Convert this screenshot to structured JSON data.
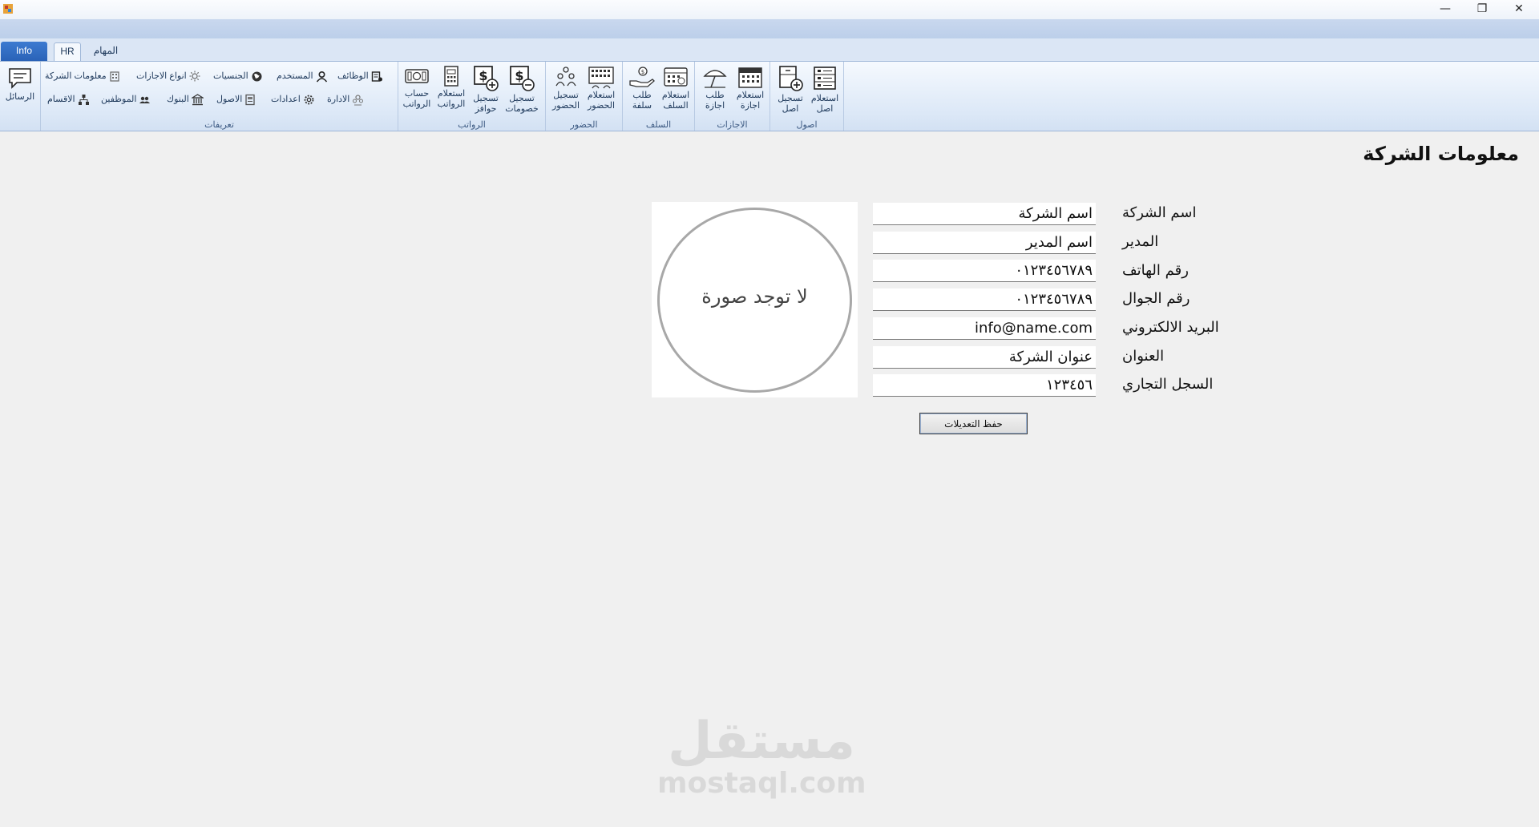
{
  "window": {
    "minimize_glyph": "—",
    "restore_glyph": "❐",
    "close_glyph": "✕"
  },
  "tabs": {
    "info": "Info",
    "hr": "HR",
    "tasks": "المهام"
  },
  "ribbon": {
    "messages": {
      "label": "الرسائل",
      "icon": "chat-icon"
    },
    "definitions": {
      "group_label": "تعريفات",
      "row1": [
        {
          "label": "الوظائف",
          "icon": "jobs-icon"
        },
        {
          "label": "المستخدم",
          "icon": "user-icon"
        },
        {
          "label": "الجنسيات",
          "icon": "globe-icon"
        },
        {
          "label": "انواع الاجازات",
          "icon": "sun-icon"
        },
        {
          "label": "معلومات الشركة",
          "icon": "building-icon"
        }
      ],
      "row2": [
        {
          "label": "الادارة",
          "icon": "management-icon"
        },
        {
          "label": "اعدادات",
          "icon": "gear-icon"
        },
        {
          "label": "الاصول",
          "icon": "assets-icon"
        },
        {
          "label": "البنوك",
          "icon": "bank-icon"
        },
        {
          "label": "الموظفين",
          "icon": "employees-icon"
        },
        {
          "label": "الاقسام",
          "icon": "org-chart-icon"
        }
      ]
    },
    "salaries": {
      "group_label": "الرواتب",
      "buttons": [
        {
          "line1": "حساب",
          "line2": "الرواتب",
          "icon": "money-calc-icon"
        },
        {
          "line1": "استعلام",
          "line2": "الرواتب",
          "icon": "salary-query-icon"
        },
        {
          "line1": "تسجيل",
          "line2": "حوافز",
          "icon": "bonus-icon"
        },
        {
          "line1": "تسجيل",
          "line2": "خصومات",
          "icon": "deduction-icon"
        }
      ]
    },
    "attendance": {
      "group_label": "الحضور",
      "buttons": [
        {
          "line1": "تسجيل",
          "line2": "الحضور",
          "icon": "attendance-register-icon"
        },
        {
          "line1": "استعلام",
          "line2": "الحضور",
          "icon": "attendance-query-icon"
        }
      ]
    },
    "advances": {
      "group_label": "السلف",
      "buttons": [
        {
          "line1": "طلب",
          "line2": "سلفة",
          "icon": "advance-request-icon"
        },
        {
          "line1": "استعلام",
          "line2": "السلف",
          "icon": "advance-query-icon"
        }
      ]
    },
    "vacations": {
      "group_label": "الاجازات",
      "buttons": [
        {
          "line1": "طلب",
          "line2": "اجازة",
          "icon": "beach-umbrella-icon"
        },
        {
          "line1": "استعلام",
          "line2": "اجازة",
          "icon": "calendar-icon"
        }
      ]
    },
    "assets": {
      "group_label": "اصول",
      "buttons": [
        {
          "line1": "تسجيل",
          "line2": "اصل",
          "icon": "asset-register-icon"
        },
        {
          "line1": "استعلام",
          "line2": "اصل",
          "icon": "asset-query-icon"
        }
      ]
    }
  },
  "page": {
    "title": "معلومات الشركة",
    "fields": [
      {
        "label": "اسم الشركة",
        "value": "اسم الشركة"
      },
      {
        "label": "المدير",
        "value": "اسم المدير"
      },
      {
        "label": "رقم الهاتف",
        "value": "٠١٢٣٤٥٦٧٨٩"
      },
      {
        "label": "رقم الجوال",
        "value": "٠١٢٣٤٥٦٧٨٩"
      },
      {
        "label": "البريد الالكتروني",
        "value": "info@name.com"
      },
      {
        "label": "العنوان",
        "value": "عنوان الشركة"
      },
      {
        "label": "السجل التجاري",
        "value": "١٢٣٤٥٦"
      }
    ],
    "photo_placeholder": "لا توجد صورة",
    "save_button": "حفظ التعديلات"
  },
  "watermark": {
    "arabic": "مستقل",
    "latin": "mostaql.com"
  }
}
